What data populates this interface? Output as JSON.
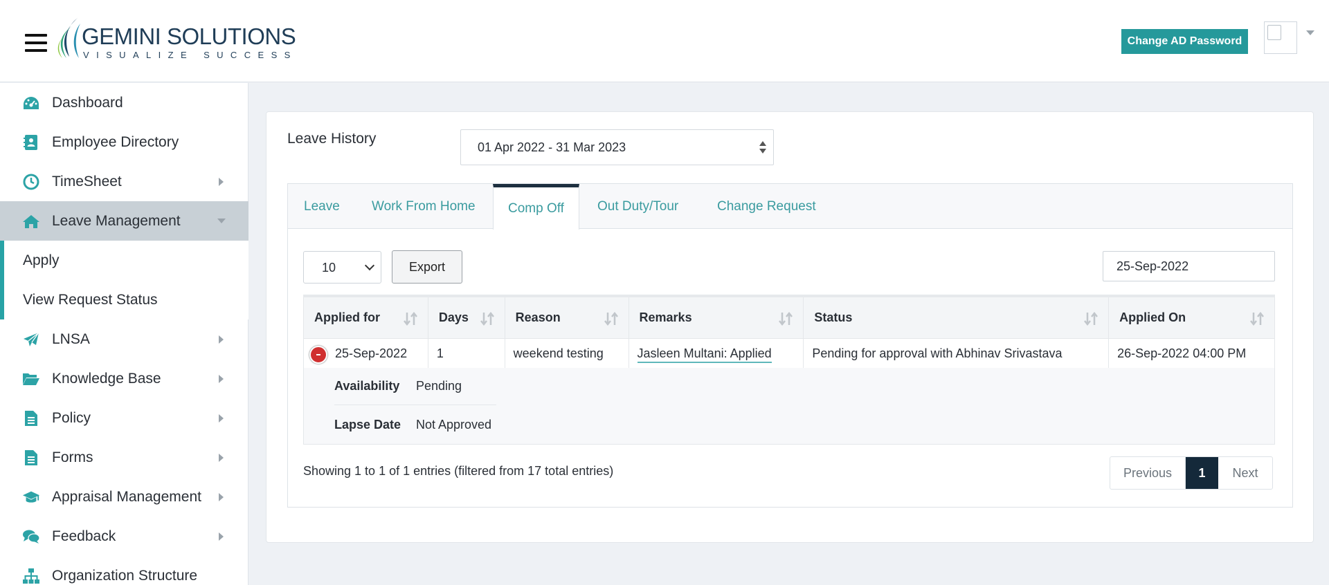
{
  "header": {
    "logo_title": "GEMINI SOLUTIONS",
    "logo_tagline": "VISUALIZE SUCCESS",
    "change_password_label": "Change AD Password"
  },
  "sidebar": {
    "items": [
      {
        "label": "Dashboard",
        "icon": "dashboard-icon"
      },
      {
        "label": "Employee Directory",
        "icon": "address-book-icon"
      },
      {
        "label": "TimeSheet",
        "icon": "clock-icon"
      },
      {
        "label": "Leave Management",
        "icon": "home-icon"
      },
      {
        "label": "LNSA",
        "icon": "paper-plane-icon"
      },
      {
        "label": "Knowledge Base",
        "icon": "folder-open-icon"
      },
      {
        "label": "Policy",
        "icon": "document-icon"
      },
      {
        "label": "Forms",
        "icon": "form-icon"
      },
      {
        "label": "Appraisal Management",
        "icon": "graduation-cap-icon"
      },
      {
        "label": "Feedback",
        "icon": "comments-icon"
      },
      {
        "label": "Organization Structure",
        "icon": "sitemap-icon"
      }
    ],
    "sub_items": [
      "Apply",
      "View Request Status"
    ]
  },
  "leave_history": {
    "title": "Leave History",
    "range": "01 Apr 2022 - 31 Mar 2023"
  },
  "tabs": [
    "Leave",
    "Work From Home",
    "Comp Off",
    "Out Duty/Tour",
    "Change Request"
  ],
  "active_tab": "Comp Off",
  "table_controls": {
    "page_length": "10",
    "export_label": "Export",
    "search_value": "25-Sep-2022"
  },
  "table": {
    "columns": [
      "Applied for",
      "Days",
      "Reason",
      "Remarks",
      "Status",
      "Applied On"
    ],
    "rows": [
      {
        "applied_for": "25-Sep-2022",
        "days": "1",
        "reason": "weekend testing",
        "remarks": "Jasleen Multani: Applied",
        "status": "Pending for approval with Abhinav Srivastava",
        "applied_on": "26-Sep-2022 04:00 PM"
      }
    ],
    "detail": {
      "availability_label": "Availability",
      "availability_value": "Pending",
      "lapse_label": "Lapse Date",
      "lapse_value": "Not Approved"
    }
  },
  "footer": {
    "info": "Showing 1 to 1 of 1 entries (filtered from 17 total entries)",
    "previous": "Previous",
    "current_page": "1",
    "next": "Next"
  },
  "colors": {
    "accent": "#25999b",
    "tab_text": "#3a9b9f",
    "active_page": "#14293a",
    "collapse_button": "#d03030"
  }
}
